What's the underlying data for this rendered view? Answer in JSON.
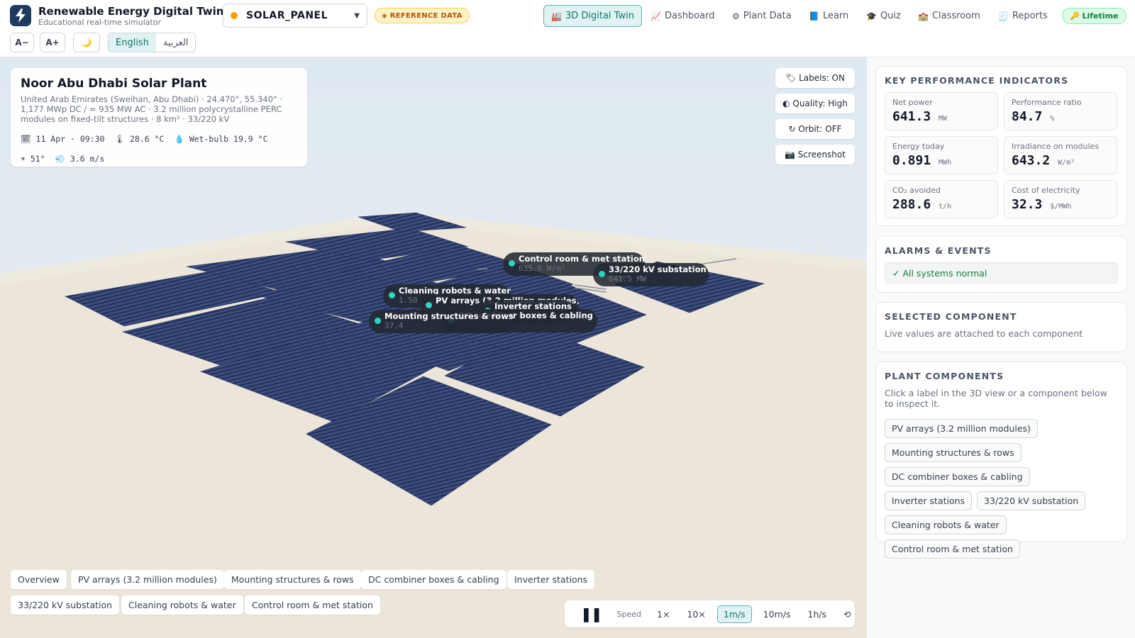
{
  "header": {
    "app_title": "Renewable Energy Digital Twin",
    "app_subtitle": "Educational real-time simulator",
    "selector_value": "SOLAR_PANEL",
    "selector_caret": "▼",
    "reference_badge": "◈ REFERENCE DATA",
    "nav": [
      {
        "icon": "🏭",
        "label": "3D Digital Twin",
        "active": true
      },
      {
        "icon": "📈",
        "label": "Dashboard"
      },
      {
        "icon": "⚙",
        "label": "Plant Data"
      },
      {
        "icon": "📘",
        "label": "Learn"
      },
      {
        "icon": "🎓",
        "label": "Quiz"
      },
      {
        "icon": "🏫",
        "label": "Classroom"
      },
      {
        "icon": "🧾",
        "label": "Reports"
      }
    ],
    "lifetime_badge": "🔑 Lifetime",
    "font_decrease": "A−",
    "font_increase": "A+",
    "dark_mode_icon": "🌙",
    "lang_english": "English",
    "lang_arabic": "العربية"
  },
  "plant_info": {
    "name": "Noor Abu Dhabi Solar Plant",
    "location_line1": "United Arab Emirates (Sweihan, Abu Dhabi) · 24.470°, 55.340° ·",
    "location_line2": "1,177 MWp DC / ≈ 935 MW AC · 3.2 million polycrystalline PERC",
    "location_line3": "modules on fixed-tilt structures · 8 km² · 33/220 kV",
    "date_time": "🗓 11 Apr · 09:30",
    "temperature": "🌡 28.6 °C",
    "wet_bulb": "💧 Wet-bulb 19.9 °C",
    "sun_angle": "☀ 51°",
    "wind": "💨 3.6 m/s"
  },
  "view_controls": {
    "labels": "🏷 Labels: ON",
    "quality": "◐ Quality: High",
    "orbit": "↻ Orbit: OFF",
    "screenshot": "📷 Screenshot"
  },
  "scene_tags": [
    {
      "name": "Control room & met station",
      "value": "635.6 W/m²"
    },
    {
      "name": "33/220 kV substation",
      "value": "641.5 MW"
    },
    {
      "name": "Cleaning robots & water",
      "value": "1.50"
    },
    {
      "name": "PV arrays (3.2 million modules)",
      "value": ""
    },
    {
      "name": "Inverter stations",
      "value": ""
    },
    {
      "name": "DC combiner boxes & cabling",
      "value": ""
    },
    {
      "name": "Mounting structures & rows",
      "value": "37.4"
    }
  ],
  "bottom_chips": [
    "Overview",
    "PV arrays (3.2 million modules)",
    "Mounting structures & rows",
    "DC combiner boxes & cabling",
    "Inverter stations",
    "33/220 kV substation",
    "Cleaning robots & water",
    "Control room & met station"
  ],
  "time_controls": {
    "pause_icon": "❚❚",
    "speed_label": "Speed",
    "options": [
      "1×",
      "10×",
      "1m/s",
      "10m/s",
      "1h/s"
    ],
    "selected": "1m/s",
    "reset_icon": "⟲"
  },
  "kpis": {
    "title": "KEY PERFORMANCE INDICATORS",
    "items": [
      {
        "label": "Net power",
        "value": "641.3",
        "unit": "MW"
      },
      {
        "label": "Performance ratio",
        "value": "84.7",
        "unit": "%"
      },
      {
        "label": "Energy today",
        "value": "0.891",
        "unit": "MWh"
      },
      {
        "label": "Irradiance on modules",
        "value": "643.2",
        "unit": "W/m²"
      },
      {
        "label": "CO₂ avoided",
        "value": "288.6",
        "unit": "t/h"
      },
      {
        "label": "Cost of electricity",
        "value": "32.3",
        "unit": "$/MWh"
      }
    ]
  },
  "alarms": {
    "title": "ALARMS & EVENTS",
    "status": "✓ All systems normal"
  },
  "selected_component": {
    "title": "SELECTED COMPONENT",
    "text": "Live values are attached to each component"
  },
  "plant_components": {
    "title": "PLANT COMPONENTS",
    "hint": "Click a label in the 3D view or a component below to inspect it.",
    "items": [
      "PV arrays (3.2 million modules)",
      "Mounting structures & rows",
      "DC combiner boxes & cabling",
      "Inverter stations",
      "33/220 kV substation",
      "Cleaning robots & water",
      "Control room & met station"
    ]
  },
  "colors": {
    "accent": "#0f766e",
    "panel_blue": "#2d3d6b",
    "ground": "#ece6da"
  }
}
